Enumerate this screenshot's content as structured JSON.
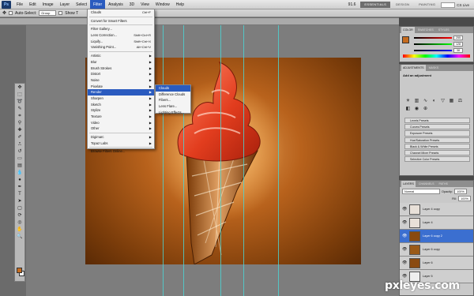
{
  "menubar": {
    "logo": "Ps",
    "items": [
      "File",
      "Edit",
      "Image",
      "Layer",
      "Select",
      "Filter",
      "Analysis",
      "3D",
      "View",
      "Window",
      "Help"
    ],
    "zoom": "91.6",
    "workspaces": [
      "ESSENTIALS",
      "DESIGN",
      "PAINTING"
    ],
    "cs_live": "CS Live"
  },
  "options": {
    "auto_select": "Auto-Select:",
    "group": "Group",
    "show_transform": "Show T"
  },
  "filter_menu": {
    "items": [
      {
        "label": "Clouds",
        "shortcut": "Ctrl+F",
        "type": "item"
      },
      {
        "type": "sep"
      },
      {
        "label": "Convert for Smart Filters",
        "type": "item"
      },
      {
        "type": "sep"
      },
      {
        "label": "Filter Gallery...",
        "type": "item"
      },
      {
        "label": "Lens Correction...",
        "shortcut": "Shift+Ctrl+R",
        "type": "item"
      },
      {
        "label": "Liquify...",
        "shortcut": "Shift+Ctrl+X",
        "type": "item"
      },
      {
        "label": "Vanishing Point...",
        "shortcut": "Alt+Ctrl+V",
        "type": "item"
      },
      {
        "type": "sep"
      },
      {
        "label": "Artistic",
        "type": "sub"
      },
      {
        "label": "Blur",
        "type": "sub"
      },
      {
        "label": "Brush Strokes",
        "type": "sub"
      },
      {
        "label": "Distort",
        "type": "sub"
      },
      {
        "label": "Noise",
        "type": "sub"
      },
      {
        "label": "Pixelate",
        "type": "sub"
      },
      {
        "label": "Render",
        "type": "sub",
        "highlight": true
      },
      {
        "label": "Sharpen",
        "type": "sub"
      },
      {
        "label": "Sketch",
        "type": "sub"
      },
      {
        "label": "Stylize",
        "type": "sub"
      },
      {
        "label": "Texture",
        "type": "sub"
      },
      {
        "label": "Video",
        "type": "sub"
      },
      {
        "label": "Other",
        "type": "sub"
      },
      {
        "type": "sep"
      },
      {
        "label": "Digimarc",
        "type": "sub"
      },
      {
        "label": "Topaz Labs",
        "type": "sub"
      },
      {
        "type": "sep"
      },
      {
        "label": "Browse Filters Online...",
        "type": "item"
      }
    ]
  },
  "render_submenu": [
    "Clouds",
    "Difference Clouds",
    "Fibers...",
    "Lens Flare...",
    "Lighting Effects..."
  ],
  "color_panel": {
    "tabs": [
      "COLOR",
      "SWATCHES",
      "STYLES"
    ],
    "r": "255",
    "g": "128",
    "b": "38"
  },
  "adjustments": {
    "tabs": [
      "ADJUSTMENTS",
      "MASKS"
    ],
    "title": "Add an adjustment",
    "icons": [
      "brightness-icon",
      "levels-icon",
      "curves-icon",
      "exposure-icon",
      "vibrance-icon",
      "hue-icon",
      "color-balance-icon",
      "bw-icon",
      "photo-filter-icon",
      "channel-mixer-icon"
    ],
    "presets": [
      "Levels Presets",
      "Curves Presets",
      "Exposure Presets",
      "Hue/Saturation Presets",
      "Black & White Presets",
      "Channel Mixer Presets",
      "Selective Color Presets"
    ]
  },
  "layers": {
    "tabs": [
      "LAYERS",
      "CHANNELS",
      "PATHS"
    ],
    "blend_mode": "Normal",
    "opacity_label": "Opacity:",
    "opacity": "100%",
    "fill_label": "Fill:",
    "fill": "100%",
    "rows": [
      {
        "name": "Layer 4 copy",
        "selected": false
      },
      {
        "name": "Layer 4",
        "selected": false
      },
      {
        "name": "Layer 6 copy 2",
        "selected": true
      },
      {
        "name": "Layer 6 copy",
        "selected": false
      },
      {
        "name": "Layer 6",
        "selected": false
      },
      {
        "name": "Layer 5",
        "selected": false
      }
    ]
  },
  "watermark": "pxleyes.com",
  "colors": {
    "accent": "#2a5bbf",
    "foreground": "#c66b1e"
  }
}
